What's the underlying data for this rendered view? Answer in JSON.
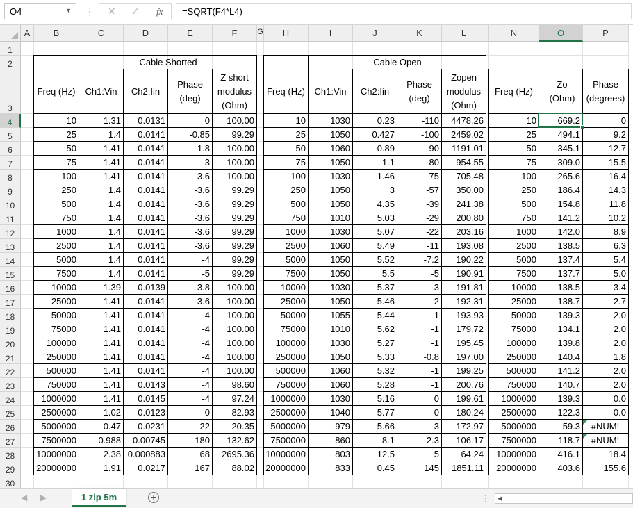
{
  "formula_bar": {
    "name_box": "O4",
    "formula": "=SQRT(F4*L4)",
    "fx": "fx",
    "cancel": "✕",
    "confirm": "✓"
  },
  "columns": [
    "A",
    "B",
    "C",
    "D",
    "E",
    "F",
    "G",
    "H",
    "I",
    "J",
    "K",
    "L",
    "M",
    "N",
    "O",
    "P"
  ],
  "selected_column": "O",
  "selected_row": 4,
  "rows": [
    1,
    2,
    3,
    4,
    5,
    6,
    7,
    8,
    9,
    10,
    11,
    12,
    13,
    14,
    15,
    16,
    17,
    18,
    19,
    20,
    21,
    22,
    23,
    24,
    25,
    26,
    27,
    28,
    29,
    30
  ],
  "titles": {
    "cable_shorted": "Cable Shorted",
    "cable_open": "Cable Open"
  },
  "headers": {
    "B": "Freq (Hz)",
    "C": "Ch1:Vin",
    "D": "Ch2:Iin",
    "E": "Phase (deg)",
    "F": "Z short modulus (Ohm)",
    "H": "Freq (Hz)",
    "I": "Ch1:Vin",
    "J": "Ch2:Iin",
    "K": "Phase (deg)",
    "L": "Zopen modulus (Ohm)",
    "N": "Freq (Hz)",
    "O": "Zo (Ohm)",
    "P": "Phase (degrees)"
  },
  "data": [
    [
      "10",
      "1.31",
      "0.0131",
      "0",
      "100.00",
      "10",
      "1030",
      "0.23",
      "-110",
      "4478.26",
      "10",
      "669.2",
      "0"
    ],
    [
      "25",
      "1.4",
      "0.0141",
      "-0.85",
      "99.29",
      "25",
      "1050",
      "0.427",
      "-100",
      "2459.02",
      "25",
      "494.1",
      "9.2"
    ],
    [
      "50",
      "1.41",
      "0.0141",
      "-1.8",
      "100.00",
      "50",
      "1060",
      "0.89",
      "-90",
      "1191.01",
      "50",
      "345.1",
      "12.7"
    ],
    [
      "75",
      "1.41",
      "0.0141",
      "-3",
      "100.00",
      "75",
      "1050",
      "1.1",
      "-80",
      "954.55",
      "75",
      "309.0",
      "15.5"
    ],
    [
      "100",
      "1.41",
      "0.0141",
      "-3.6",
      "100.00",
      "100",
      "1030",
      "1.46",
      "-75",
      "705.48",
      "100",
      "265.6",
      "16.4"
    ],
    [
      "250",
      "1.4",
      "0.0141",
      "-3.6",
      "99.29",
      "250",
      "1050",
      "3",
      "-57",
      "350.00",
      "250",
      "186.4",
      "14.3"
    ],
    [
      "500",
      "1.4",
      "0.0141",
      "-3.6",
      "99.29",
      "500",
      "1050",
      "4.35",
      "-39",
      "241.38",
      "500",
      "154.8",
      "11.8"
    ],
    [
      "750",
      "1.4",
      "0.0141",
      "-3.6",
      "99.29",
      "750",
      "1010",
      "5.03",
      "-29",
      "200.80",
      "750",
      "141.2",
      "10.2"
    ],
    [
      "1000",
      "1.4",
      "0.0141",
      "-3.6",
      "99.29",
      "1000",
      "1030",
      "5.07",
      "-22",
      "203.16",
      "1000",
      "142.0",
      "8.9"
    ],
    [
      "2500",
      "1.4",
      "0.0141",
      "-3.6",
      "99.29",
      "2500",
      "1060",
      "5.49",
      "-11",
      "193.08",
      "2500",
      "138.5",
      "6.3"
    ],
    [
      "5000",
      "1.4",
      "0.0141",
      "-4",
      "99.29",
      "5000",
      "1050",
      "5.52",
      "-7.2",
      "190.22",
      "5000",
      "137.4",
      "5.4"
    ],
    [
      "7500",
      "1.4",
      "0.0141",
      "-5",
      "99.29",
      "7500",
      "1050",
      "5.5",
      "-5",
      "190.91",
      "7500",
      "137.7",
      "5.0"
    ],
    [
      "10000",
      "1.39",
      "0.0139",
      "-3.8",
      "100.00",
      "10000",
      "1030",
      "5.37",
      "-3",
      "191.81",
      "10000",
      "138.5",
      "3.4"
    ],
    [
      "25000",
      "1.41",
      "0.0141",
      "-3.6",
      "100.00",
      "25000",
      "1050",
      "5.46",
      "-2",
      "192.31",
      "25000",
      "138.7",
      "2.7"
    ],
    [
      "50000",
      "1.41",
      "0.0141",
      "-4",
      "100.00",
      "50000",
      "1055",
      "5.44",
      "-1",
      "193.93",
      "50000",
      "139.3",
      "2.0"
    ],
    [
      "75000",
      "1.41",
      "0.0141",
      "-4",
      "100.00",
      "75000",
      "1010",
      "5.62",
      "-1",
      "179.72",
      "75000",
      "134.1",
      "2.0"
    ],
    [
      "100000",
      "1.41",
      "0.0141",
      "-4",
      "100.00",
      "100000",
      "1030",
      "5.27",
      "-1",
      "195.45",
      "100000",
      "139.8",
      "2.0"
    ],
    [
      "250000",
      "1.41",
      "0.0141",
      "-4",
      "100.00",
      "250000",
      "1050",
      "5.33",
      "-0.8",
      "197.00",
      "250000",
      "140.4",
      "1.8"
    ],
    [
      "500000",
      "1.41",
      "0.0141",
      "-4",
      "100.00",
      "500000",
      "1060",
      "5.32",
      "-1",
      "199.25",
      "500000",
      "141.2",
      "2.0"
    ],
    [
      "750000",
      "1.41",
      "0.0143",
      "-4",
      "98.60",
      "750000",
      "1060",
      "5.28",
      "-1",
      "200.76",
      "750000",
      "140.7",
      "2.0"
    ],
    [
      "1000000",
      "1.41",
      "0.0145",
      "-4",
      "97.24",
      "1000000",
      "1030",
      "5.16",
      "0",
      "199.61",
      "1000000",
      "139.3",
      "0.0"
    ],
    [
      "2500000",
      "1.02",
      "0.0123",
      "0",
      "82.93",
      "2500000",
      "1040",
      "5.77",
      "0",
      "180.24",
      "2500000",
      "122.3",
      "0.0"
    ],
    [
      "5000000",
      "0.47",
      "0.0231",
      "22",
      "20.35",
      "5000000",
      "979",
      "5.66",
      "-3",
      "172.97",
      "5000000",
      "59.3",
      "#NUM!"
    ],
    [
      "7500000",
      "0.988",
      "0.00745",
      "180",
      "132.62",
      "7500000",
      "860",
      "8.1",
      "-2.3",
      "106.17",
      "7500000",
      "118.7",
      "#NUM!"
    ],
    [
      "10000000",
      "2.38",
      "0.000883",
      "68",
      "2695.36",
      "10000000",
      "803",
      "12.5",
      "5",
      "64.24",
      "10000000",
      "416.1",
      "18.4"
    ],
    [
      "20000000",
      "1.91",
      "0.0217",
      "167",
      "88.02",
      "20000000",
      "833",
      "0.45",
      "145",
      "1851.11",
      "20000000",
      "403.6",
      "155.6"
    ]
  ],
  "sheet_tab": "1 zip 5m",
  "add_sheet": "+",
  "colors": {
    "accent": "#217346",
    "header_bg": "#efefef"
  }
}
